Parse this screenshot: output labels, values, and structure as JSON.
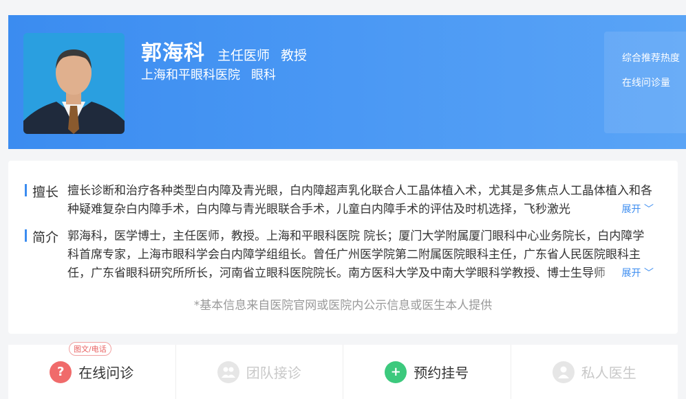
{
  "doctor": {
    "name": "郭海科",
    "title": "主任医师",
    "rank": "教授",
    "hospital": "上海和平眼科医院",
    "department": "眼科"
  },
  "stats": {
    "recommend_label": "综合推荐热度",
    "consult_label": "在线问诊量"
  },
  "specialty": {
    "label": "擅长",
    "text": "擅长诊断和治疗各种类型白内障及青光眼，白内障超声乳化联合人工晶体植入术，尤其是多焦点人工晶体植入和各种疑难复杂白内障手术，白内障与青光眼联合手术，儿童白内障手术的评估及时机选择，飞秒激光",
    "expand": "展开"
  },
  "intro": {
    "label": "简介",
    "text": "郭海科，医学博士，主任医师，教授。上海和平眼科医院 院长；厦门大学附属厦门眼科中心业务院长，白内障学科首席专家，上海市眼科学会白内障学组组长。曾任广州医学院第二附属医院眼科主任，广东省人民医院眼科主任，广东省眼科研究所所长，河南省立眼科医院院长。南方医科大学及中南大学眼科学教授、博士生导师",
    "expand": "展开"
  },
  "footnote": "*基本信息来自医院官网或医院内公示信息或医生本人提供",
  "services": [
    {
      "label": "在线问诊",
      "tag": "图文/电话",
      "icon": "question-icon",
      "color": "#f06b6b",
      "enabled": true
    },
    {
      "label": "团队接诊",
      "icon": "team-icon",
      "enabled": false
    },
    {
      "label": "预约挂号",
      "icon": "plus-icon",
      "color": "#3cc97d",
      "enabled": true
    },
    {
      "label": "私人医生",
      "icon": "person-icon",
      "enabled": false
    }
  ]
}
